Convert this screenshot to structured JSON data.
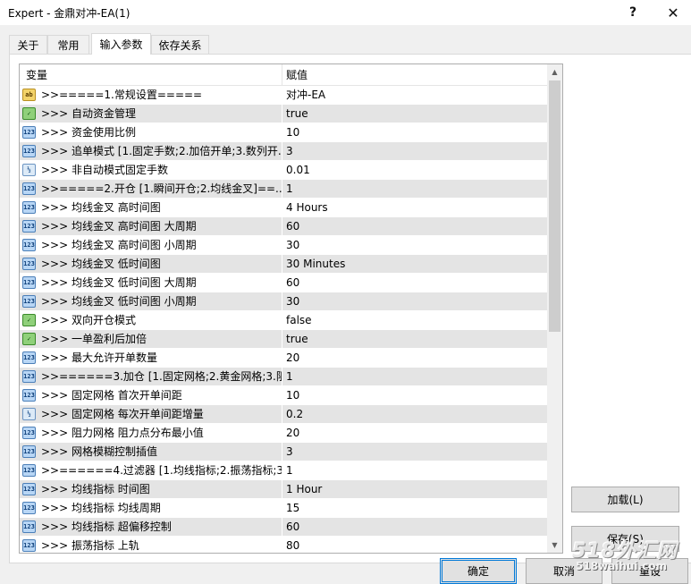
{
  "window": {
    "title": "Expert - 金鼎对冲-EA(1)",
    "help_label": "?",
    "close_label": "✕"
  },
  "tabs": [
    {
      "label": "关于"
    },
    {
      "label": "常用"
    },
    {
      "label": "输入参数"
    },
    {
      "label": "依存关系"
    }
  ],
  "active_tab": "输入参数",
  "list": {
    "header": {
      "variable": "变量",
      "value": "赋值"
    },
    "rows": [
      {
        "icon": "string",
        "icon_text": "ab",
        "name": ">>=====1.常规设置=====",
        "value": "对冲-EA"
      },
      {
        "icon": "bool",
        "icon_text": "✓",
        "name": ">>>   自动资金管理",
        "value": "true"
      },
      {
        "icon": "int",
        "icon_text": "123",
        "name": ">>>   资金使用比例",
        "value": "10"
      },
      {
        "icon": "int",
        "icon_text": "123",
        "name": ">>>   追单模式 [1.固定手数;2.加倍开单;3.数列开...",
        "value": "3"
      },
      {
        "icon": "double",
        "icon_text": "½",
        "name": ">>>   非自动模式固定手数",
        "value": "0.01"
      },
      {
        "icon": "int",
        "icon_text": "123",
        "name": ">>=====2.开仓 [1.瞬间开仓;2.均线金叉]==...",
        "value": "1"
      },
      {
        "icon": "int",
        "icon_text": "123",
        "name": ">>>   均线金叉 高时间图",
        "value": "4 Hours"
      },
      {
        "icon": "int",
        "icon_text": "123",
        "name": ">>>   均线金叉 高时间图 大周期",
        "value": "60"
      },
      {
        "icon": "int",
        "icon_text": "123",
        "name": ">>>   均线金叉 高时间图 小周期",
        "value": "30"
      },
      {
        "icon": "int",
        "icon_text": "123",
        "name": ">>>   均线金叉 低时间图",
        "value": "30 Minutes"
      },
      {
        "icon": "int",
        "icon_text": "123",
        "name": ">>>   均线金叉 低时间图 大周期",
        "value": "60"
      },
      {
        "icon": "int",
        "icon_text": "123",
        "name": ">>>   均线金叉 低时间图 小周期",
        "value": "30"
      },
      {
        "icon": "bool",
        "icon_text": "✓",
        "name": ">>>   双向开仓模式",
        "value": "false"
      },
      {
        "icon": "bool",
        "icon_text": "✓",
        "name": ">>>   一单盈利后加倍",
        "value": "true"
      },
      {
        "icon": "int",
        "icon_text": "123",
        "name": ">>>   最大允许开单数量",
        "value": "20"
      },
      {
        "icon": "int",
        "icon_text": "123",
        "name": ">>======3.加仓 [1.固定网格;2.黄金网格;3.阻...",
        "value": "1"
      },
      {
        "icon": "int",
        "icon_text": "123",
        "name": ">>>   固定网格 首次开单间距",
        "value": "10"
      },
      {
        "icon": "double",
        "icon_text": "½",
        "name": ">>>   固定网格 每次开单间距增量",
        "value": "0.2"
      },
      {
        "icon": "int",
        "icon_text": "123",
        "name": ">>>   阻力网格 阻力点分布最小值",
        "value": "20"
      },
      {
        "icon": "int",
        "icon_text": "123",
        "name": ">>>   网格模糊控制插值",
        "value": "3"
      },
      {
        "icon": "int",
        "icon_text": "123",
        "name": ">>======4.过滤器 [1.均线指标;2.振荡指标;3....",
        "value": "1"
      },
      {
        "icon": "int",
        "icon_text": "123",
        "name": ">>>   均线指标 时间图",
        "value": "1 Hour"
      },
      {
        "icon": "int",
        "icon_text": "123",
        "name": ">>>   均线指标 均线周期",
        "value": "15"
      },
      {
        "icon": "int",
        "icon_text": "123",
        "name": ">>>   均线指标 超偏移控制",
        "value": "60"
      },
      {
        "icon": "int",
        "icon_text": "123",
        "name": ">>>   振荡指标 上轨",
        "value": "80"
      }
    ]
  },
  "scrollbar": {
    "position": 0.0,
    "visible_fraction": 0.55
  },
  "buttons": {
    "load": "加载(L)",
    "save": "保存(S)",
    "ok": "确定",
    "cancel": "取消",
    "reset": "重设"
  },
  "watermark": {
    "big": "518外汇网",
    "small": "518waihui.com"
  }
}
